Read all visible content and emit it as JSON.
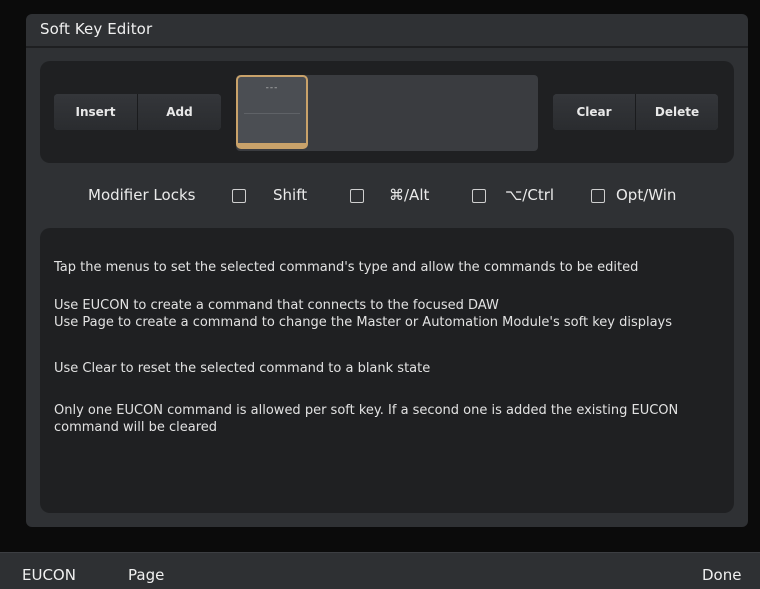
{
  "editor": {
    "title": "Soft Key Editor"
  },
  "toolbar": {
    "insert_label": "Insert",
    "add_label": "Add",
    "clear_label": "Clear",
    "delete_label": "Delete",
    "softkey_text": "---",
    "accent_color": "#c9a26a"
  },
  "modifiers": {
    "label": "Modifier Locks",
    "options": [
      {
        "label": "Shift",
        "checked": false
      },
      {
        "label": "⌘/Alt",
        "checked": false
      },
      {
        "label": "⌥/Ctrl",
        "checked": false
      },
      {
        "label": "Opt/Win",
        "checked": false
      }
    ]
  },
  "info": {
    "lines": [
      "Tap the menus to set the selected command's type and allow the commands to be edited",
      "Use EUCON to create a command that connects to the focused DAW",
      "Use Page to create a command to change the Master or Automation Module's soft key displays",
      "Use Clear to reset the selected command to a blank state",
      "Only one EUCON command is allowed per soft key.  If a second one is added the existing EUCON command will be cleared"
    ]
  },
  "bottom_bar": {
    "eucon_label": "EUCON",
    "page_label": "Page",
    "done_label": "Done"
  }
}
